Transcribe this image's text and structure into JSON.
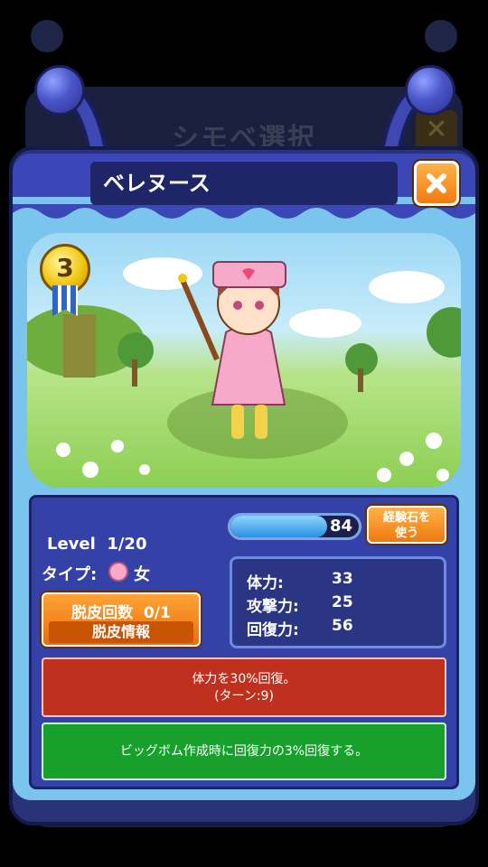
{
  "background": {
    "title": "シモベ選択"
  },
  "dialog": {
    "character_name": "ベレヌース",
    "close_icon": "close-x-icon"
  },
  "character": {
    "rank": "3"
  },
  "stats": {
    "exp_value": "84",
    "exp_fill_fraction": 0.75,
    "use_exp_stone_label_line1": "経験石を",
    "use_exp_stone_label_line2": "使う",
    "level_text": "Level  1/20",
    "type_label": "タイプ:",
    "type_icon": "pink-face-icon",
    "type_value": "女",
    "molt_count_text": "脱皮回数  0/1",
    "molt_info_label": "脱皮情報",
    "attributes": [
      {
        "label": "体力:",
        "value": "33"
      },
      {
        "label": "攻撃力:",
        "value": "25"
      },
      {
        "label": "回復力:",
        "value": "56"
      }
    ]
  },
  "skills": {
    "active_line1": "体力を30%回復。",
    "active_line2": "(ターン:9)",
    "passive": "ビッグボム作成時に回復力の3%回復する。"
  },
  "colors": {
    "dialog_blue": "#3b47b6",
    "panel_blue": "#3442a8",
    "orange_button": "#ee7a10",
    "active_skill_red": "#c0301e",
    "passive_skill_green": "#18a02c"
  }
}
